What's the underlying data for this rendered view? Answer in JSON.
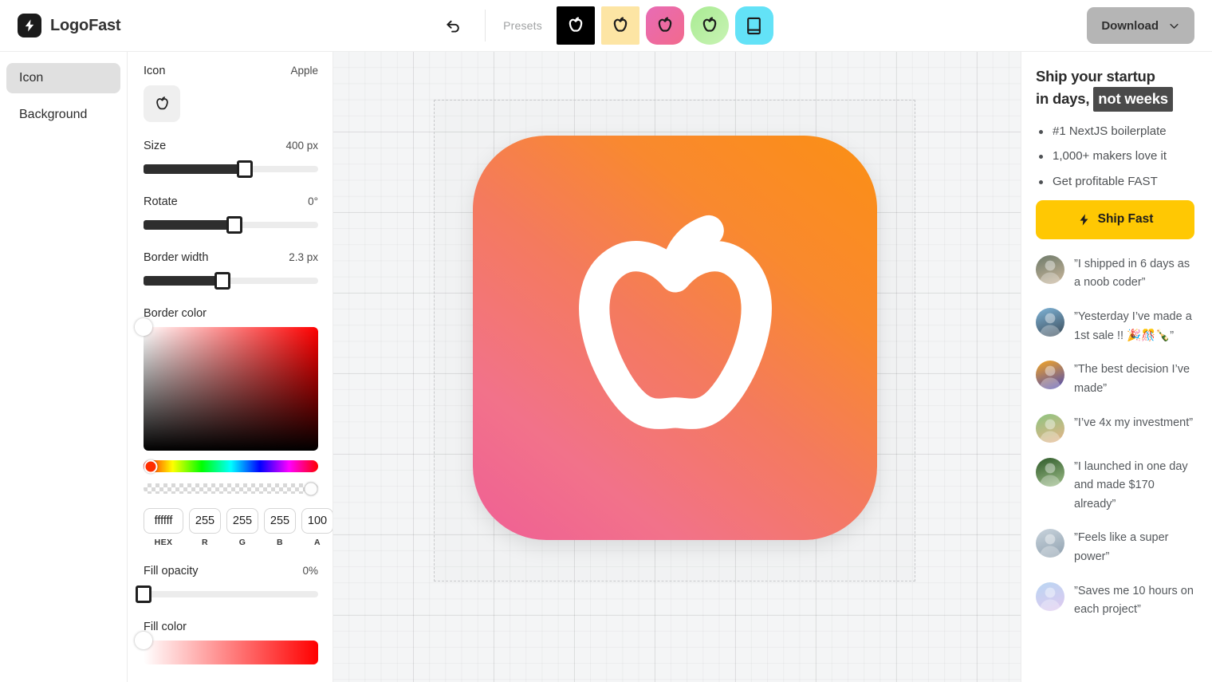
{
  "brand": {
    "name": "LogoFast",
    "mark_icon": "lightning-bolt-icon"
  },
  "header": {
    "undo_icon": "undo-arrow-icon",
    "presets_label": "Presets",
    "presets": [
      {
        "name": "preset-black-apple",
        "shape": "square",
        "bg": "#000000",
        "icon": "apple-icon",
        "icon_color": "#ffffff"
      },
      {
        "name": "preset-yellow-apple",
        "shape": "square",
        "bg": "#fde5a4",
        "icon": "apple-icon",
        "icon_color": "#1d1d1d"
      },
      {
        "name": "preset-pink-apple",
        "shape": "rounded",
        "bg": "#e86bb5",
        "bg2": "#f26a8d",
        "icon": "apple-icon",
        "icon_color": "#1d1d1d"
      },
      {
        "name": "preset-green-apple",
        "shape": "circle",
        "bg": "#a9eb93",
        "bg2": "#c8f3b4",
        "icon": "apple-icon",
        "icon_color": "#1d1d1d"
      },
      {
        "name": "preset-cyan-book",
        "shape": "rounded",
        "bg": "#63e2f7",
        "icon": "book-icon",
        "icon_color": "#1d1d1d"
      }
    ],
    "download_label": "Download",
    "download_chevron_icon": "chevron-down-icon"
  },
  "sidebar": {
    "items": [
      {
        "label": "Icon",
        "active": true
      },
      {
        "label": "Background",
        "active": false
      }
    ]
  },
  "controls": {
    "icon": {
      "label": "Icon",
      "value": "Apple",
      "swatch_icon": "apple-icon"
    },
    "size": {
      "label": "Size",
      "value": "400 px",
      "percent": 58
    },
    "rotate": {
      "label": "Rotate",
      "value": "0°",
      "percent": 52
    },
    "border_width": {
      "label": "Border width",
      "value": "2.3 px",
      "percent": 45
    },
    "border_color": {
      "label": "Border color",
      "sv_x": 0,
      "sv_y": 0,
      "hue_percent": 4,
      "alpha_percent": 96,
      "hex": "ffffff",
      "r": "255",
      "g": "255",
      "b": "255",
      "a": "100",
      "cap_hex": "HEX",
      "cap_r": "R",
      "cap_g": "G",
      "cap_b": "B",
      "cap_a": "A"
    },
    "fill_opacity": {
      "label": "Fill opacity",
      "value": "0%",
      "percent": 0
    },
    "fill_color": {
      "label": "Fill color",
      "sv_x": 0
    }
  },
  "canvas": {
    "logo": {
      "icon": "apple-icon",
      "gradient_from": "#ef5f95",
      "gradient_to": "#fb8f14",
      "icon_color": "#ffffff"
    }
  },
  "promo": {
    "heading_line1": "Ship your startup",
    "heading_line2_pre": "in days,",
    "heading_line2_hl": "not weeks",
    "bullets": [
      "#1 NextJS boilerplate",
      "1,000+ makers love it",
      "Get profitable FAST"
    ],
    "cta_label": "Ship Fast",
    "cta_icon": "lightning-bolt-icon",
    "cta_color": "#ffc803",
    "testimonials": [
      {
        "text": "”I shipped in 6 days as a noob coder”",
        "av1": "#6d7a6a",
        "av2": "#cbb79c"
      },
      {
        "text": "”Yesterday I’ve made a 1st sale !! 🎉🎊🍾”",
        "av1": "#7fb4d8",
        "av2": "#3a4a57"
      },
      {
        "text": "”The best decision I’ve made”",
        "av1": "#f5a623",
        "av2": "#4a4ab8"
      },
      {
        "text": "”I’ve 4x my investment”",
        "av1": "#8dc47f",
        "av2": "#e8b48a"
      },
      {
        "text": "”I launched in one day and made $170 already”",
        "av1": "#2f5a2a",
        "av2": "#9fbf8a"
      },
      {
        "text": "”Feels like a super power”",
        "av1": "#c9d4dd",
        "av2": "#8fa0ae"
      },
      {
        "text": "”Saves me 10 hours on each project”",
        "av1": "#b9d6f2",
        "av2": "#e0c9f0"
      }
    ]
  }
}
